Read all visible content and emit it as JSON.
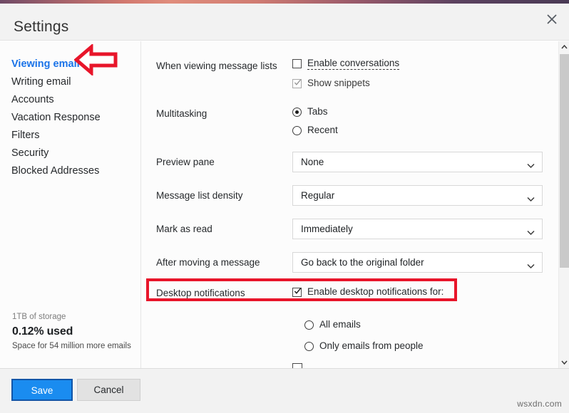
{
  "window": {
    "title": "Settings",
    "close_icon": "close-icon",
    "accent_strip_colors": [
      "#6f4a66",
      "#d2796f",
      "#4a3a55"
    ]
  },
  "sidebar": {
    "items": [
      {
        "label": "Viewing email",
        "active": true
      },
      {
        "label": "Writing email",
        "active": false
      },
      {
        "label": "Accounts",
        "active": false
      },
      {
        "label": "Vacation Response",
        "active": false
      },
      {
        "label": "Filters",
        "active": false
      },
      {
        "label": "Security",
        "active": false
      },
      {
        "label": "Blocked Addresses",
        "active": false
      }
    ],
    "storage": {
      "capacity": "1TB of storage",
      "used": "0.12% used",
      "note": "Space for 54 million more emails"
    }
  },
  "content": {
    "rows": [
      {
        "label": "When viewing message lists",
        "checkboxes": [
          {
            "label": "Enable conversations",
            "checked": false,
            "disabled": false,
            "dashed_underline": true
          },
          {
            "label": "Show snippets",
            "checked": true,
            "disabled": true,
            "dashed_underline": false
          }
        ]
      },
      {
        "label": "Multitasking",
        "radios": [
          {
            "label": "Tabs",
            "selected": true
          },
          {
            "label": "Recent",
            "selected": false
          }
        ]
      },
      {
        "label": "Preview pane",
        "select_value": "None"
      },
      {
        "label": "Message list density",
        "select_value": "Regular"
      },
      {
        "label": "Mark as read",
        "select_value": "Immediately"
      },
      {
        "label": "After moving a message",
        "select_value": "Go back to the original folder"
      },
      {
        "label": "Desktop notifications",
        "checkbox": {
          "label": "Enable desktop notifications for:",
          "checked": true
        },
        "radios": [
          {
            "label": "All emails",
            "selected": false
          },
          {
            "label": "Only emails from people",
            "selected": false
          }
        ]
      }
    ]
  },
  "annotations": {
    "arrow_color": "#e8152a",
    "highlight_color": "#e8152a",
    "arrow_target": "Viewing email",
    "highlight_target": "Desktop notifications"
  },
  "scrollbar": {
    "up_icon": "chevron-up-icon",
    "down_icon": "chevron-down-icon"
  },
  "footer": {
    "save_label": "Save",
    "cancel_label": "Cancel"
  },
  "watermark": "wsxdn.com"
}
